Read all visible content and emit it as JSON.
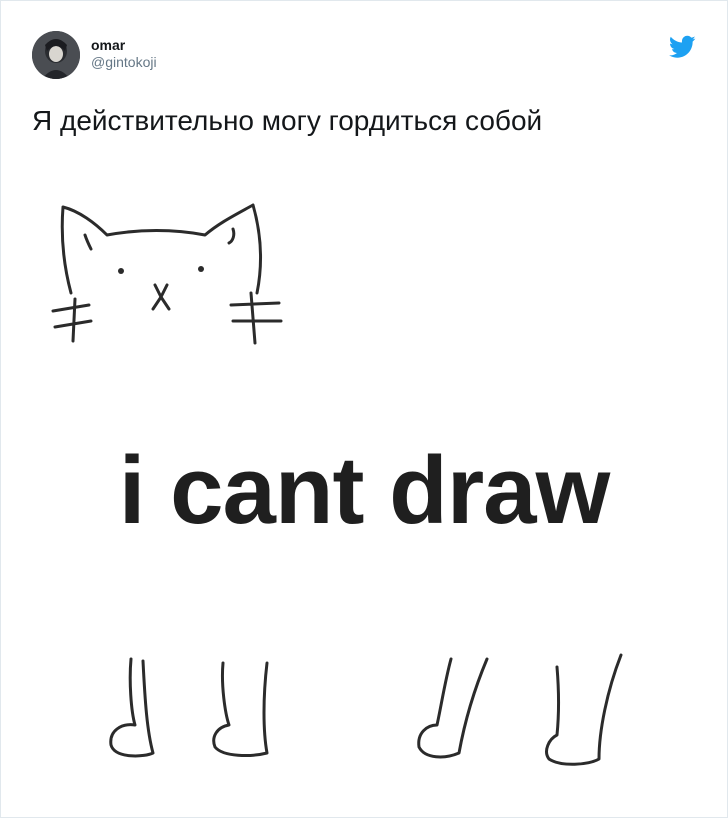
{
  "tweet": {
    "author_name": "omar",
    "author_handle": "@gintokoji",
    "text": "Я действительно могу гордиться собой",
    "brand_icon": "twitter-bird-icon",
    "brand_color": "#1da1f2"
  },
  "media": {
    "caption": "i cant draw"
  }
}
